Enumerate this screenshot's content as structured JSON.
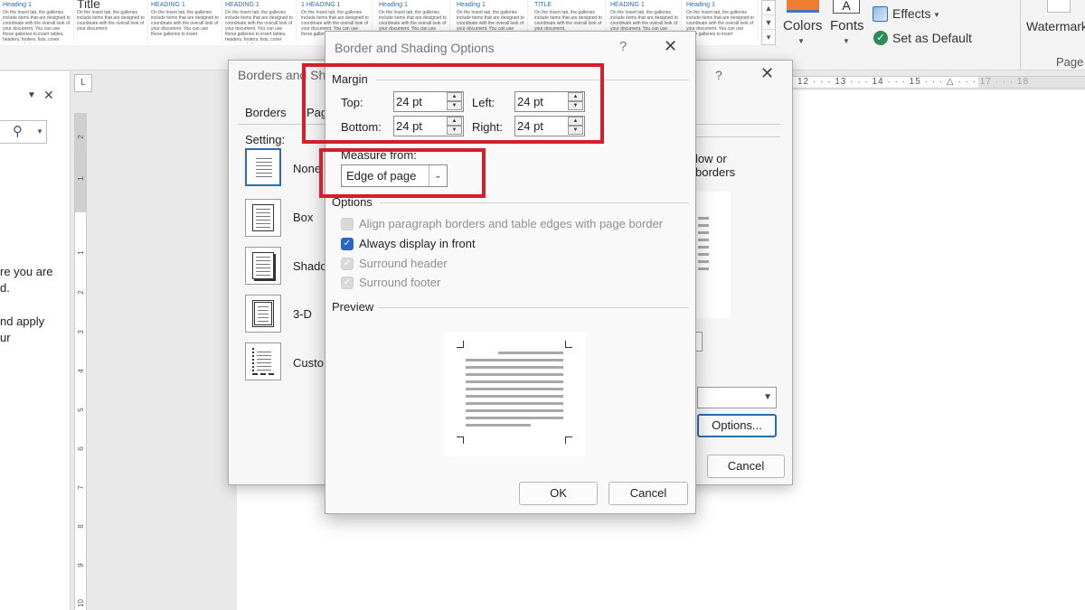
{
  "ribbon": {
    "styles": [
      {
        "heading": "Heading 1",
        "big": false,
        "text": "On the Insert tab, the galleries include items that are designed to coordinate with the overall look of your document. You can use these galleries to insert tables, headers, footers, lists, cover pages, and other"
      },
      {
        "heading": "Title",
        "big": true,
        "text": "On the Insert tab, the galleries include items that are designed to coordinate with the overall look of your document."
      },
      {
        "heading": "HEADING 1",
        "big": false,
        "text": "On the Insert tab, the galleries include items that are designed to coordinate with the overall look of your document. You can use these galleries to insert"
      },
      {
        "heading": "HEADING 1",
        "big": false,
        "text": "On the Insert tab, the galleries include items that are designed to coordinate with the overall look of your document. You can use these galleries to insert tables, headers, footers, lists, cover pages, and other"
      },
      {
        "heading": "1 HEADING 1",
        "big": false,
        "text": "On the Insert tab, the galleries include items that are designed to coordinate with the overall look of your document. You can use these galleries to insert"
      },
      {
        "heading": "Heading 1",
        "big": false,
        "text": "On the Insert tab, the galleries include items that are designed to coordinate with the overall look of your document. You can use these galleries to insert"
      },
      {
        "heading": "Heading 1",
        "big": false,
        "text": "On the Insert tab, the galleries include items that are designed to coordinate with the overall look of your document. You can use these galleries to insert"
      },
      {
        "heading": "TITLE",
        "big": false,
        "text": "On the Insert tab, the galleries include items that are designed to coordinate with the overall look of your document."
      },
      {
        "heading": "HEADING 1",
        "big": false,
        "text": "On the Insert tab, the galleries include items that are designed to coordinate with the overall look of your document. You can use these galleries to insert"
      },
      {
        "heading": "Heading 1",
        "big": false,
        "text": "On the Insert tab, the galleries include items that are designed to coordinate with the overall look of your document. You can use these galleries to insert"
      }
    ],
    "colors_label": "Colors",
    "fonts_label": "Fonts",
    "effects_label": "Effects",
    "set_default_label": "Set as Default",
    "watermark_label": "Watermark",
    "page_group_label": "Page"
  },
  "nav": {
    "text_lines": [
      "re you are",
      "d.",
      "nd apply",
      "ur"
    ]
  },
  "ruler": {
    "vertical_numbers": [
      "2",
      "1",
      "1",
      "2",
      "3",
      "4",
      "5",
      "6",
      "7",
      "8",
      "9",
      "10"
    ],
    "horizontal_text": "12 · · · 13 · · · 14 · · · 15 · · · △ · · · 17 · · · 18"
  },
  "borders_dialog": {
    "title": "Borders and Sh",
    "tabs": [
      "Borders",
      "Pag"
    ],
    "setting_label": "Setting:",
    "settings": [
      "None",
      "Box",
      "Shado",
      "3-D",
      "Custo"
    ],
    "right_text": [
      "low or",
      "borders"
    ],
    "options_button": "Options...",
    "cancel_button": "Cancel"
  },
  "options_dialog": {
    "title": "Border and Shading Options",
    "help": "?",
    "margin": {
      "label": "Margin",
      "top_label": "Top:",
      "top_value": "24 pt",
      "left_label": "Left:",
      "left_value": "24 pt",
      "bottom_label": "Bottom:",
      "bottom_value": "24 pt",
      "right_label": "Right:",
      "right_value": "24 pt"
    },
    "measure_from": {
      "label": "Measure from:",
      "value": "Edge of page"
    },
    "options": {
      "label": "Options",
      "items": [
        {
          "label": "Align paragraph borders and table edges with page border",
          "checked": false,
          "disabled": true
        },
        {
          "label": "Always display in front",
          "checked": true,
          "disabled": false
        },
        {
          "label": "Surround header",
          "checked": true,
          "disabled": true
        },
        {
          "label": "Surround footer",
          "checked": true,
          "disabled": true
        }
      ]
    },
    "preview_label": "Preview",
    "ok_button": "OK",
    "cancel_button": "Cancel"
  },
  "colors": {
    "highlight": "#d0202b",
    "accent": "#2966c7"
  }
}
